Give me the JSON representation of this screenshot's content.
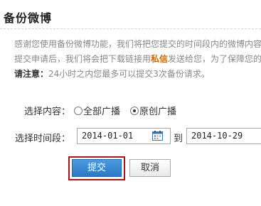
{
  "header": {
    "title": "备份微博"
  },
  "description": {
    "line1": "感谢您使用备份微博功能，我们将把您提交的时间段内的微博内容",
    "line2_before": "提交申请后，我们将会把下载链接用",
    "line2_highlight": "私信",
    "line2_after": "发送给您，为了保障您的",
    "note_label": "请注意：",
    "note_text": "24小时之内您最多可以提交3次备份请求。"
  },
  "content_select": {
    "label": "选择内容：",
    "options": [
      {
        "label": "全部广播",
        "checked": false
      },
      {
        "label": "原创广播",
        "checked": true
      }
    ]
  },
  "time_select": {
    "label": "选择时间段：",
    "start_date": "2014-01-01",
    "to_label": "到",
    "end_date": "2014-10-29",
    "calendar_icon": "calendar-icon"
  },
  "actions": {
    "submit_label": "提交",
    "cancel_label": "取消"
  },
  "colors": {
    "highlight_text": "#d06a00",
    "submit_button": "#2b79c4",
    "highlight_box": "#b01116"
  }
}
